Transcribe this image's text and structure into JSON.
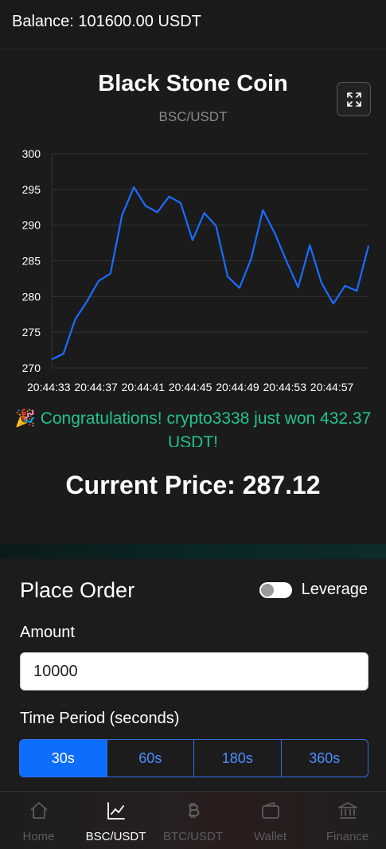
{
  "header": {
    "balance": "Balance: 101600.00 USDT"
  },
  "coin": {
    "title": "Black Stone Coin",
    "pair": "BSC/USDT",
    "expand_icon": "expand-icon"
  },
  "chart_data": {
    "type": "line",
    "title": "",
    "xlabel": "",
    "ylabel": "",
    "ylim": [
      270,
      300
    ],
    "yticks": [
      270,
      275,
      280,
      285,
      290,
      295,
      300
    ],
    "xtick_labels": [
      "20:44:33",
      "20:44:37",
      "20:44:41",
      "20:44:45",
      "20:44:49",
      "20:44:53",
      "20:44:57"
    ],
    "grid": true,
    "color": "#1a6dff",
    "values": [
      271.2,
      272.0,
      276.8,
      279.3,
      282.2,
      283.2,
      291.4,
      295.3,
      292.7,
      291.8,
      294.0,
      293.1,
      287.9,
      291.7,
      289.9,
      282.8,
      281.2,
      285.3,
      292.1,
      288.9,
      285.0,
      281.3,
      287.2,
      281.9,
      279.0,
      281.5,
      280.8,
      287.1
    ]
  },
  "announcement": {
    "icon": "party-popper-icon",
    "text": "Congratulations! crypto3338 just won 432.37 USDT!"
  },
  "price": {
    "current": "Current Price: 287.12"
  },
  "order": {
    "title": "Place Order",
    "leverage_label": "Leverage",
    "leverage_on": false,
    "amount_label": "Amount",
    "amount_value": "10000",
    "period_label": "Time Period (seconds)",
    "periods": [
      "30s",
      "60s",
      "180s",
      "360s"
    ],
    "selected_period": "30s"
  },
  "nav": {
    "items": [
      {
        "label": "Home",
        "icon": "home-icon"
      },
      {
        "label": "BSC/USDT",
        "icon": "chart-line-icon"
      },
      {
        "label": "BTC/USDT",
        "icon": "bitcoin-icon"
      },
      {
        "label": "Wallet",
        "icon": "wallet-icon"
      },
      {
        "label": "Finance",
        "icon": "bank-icon"
      }
    ],
    "active": "BSC/USDT"
  },
  "colors": {
    "accent": "#0d6efd",
    "success": "#21c48f",
    "line": "#1a6dff"
  }
}
